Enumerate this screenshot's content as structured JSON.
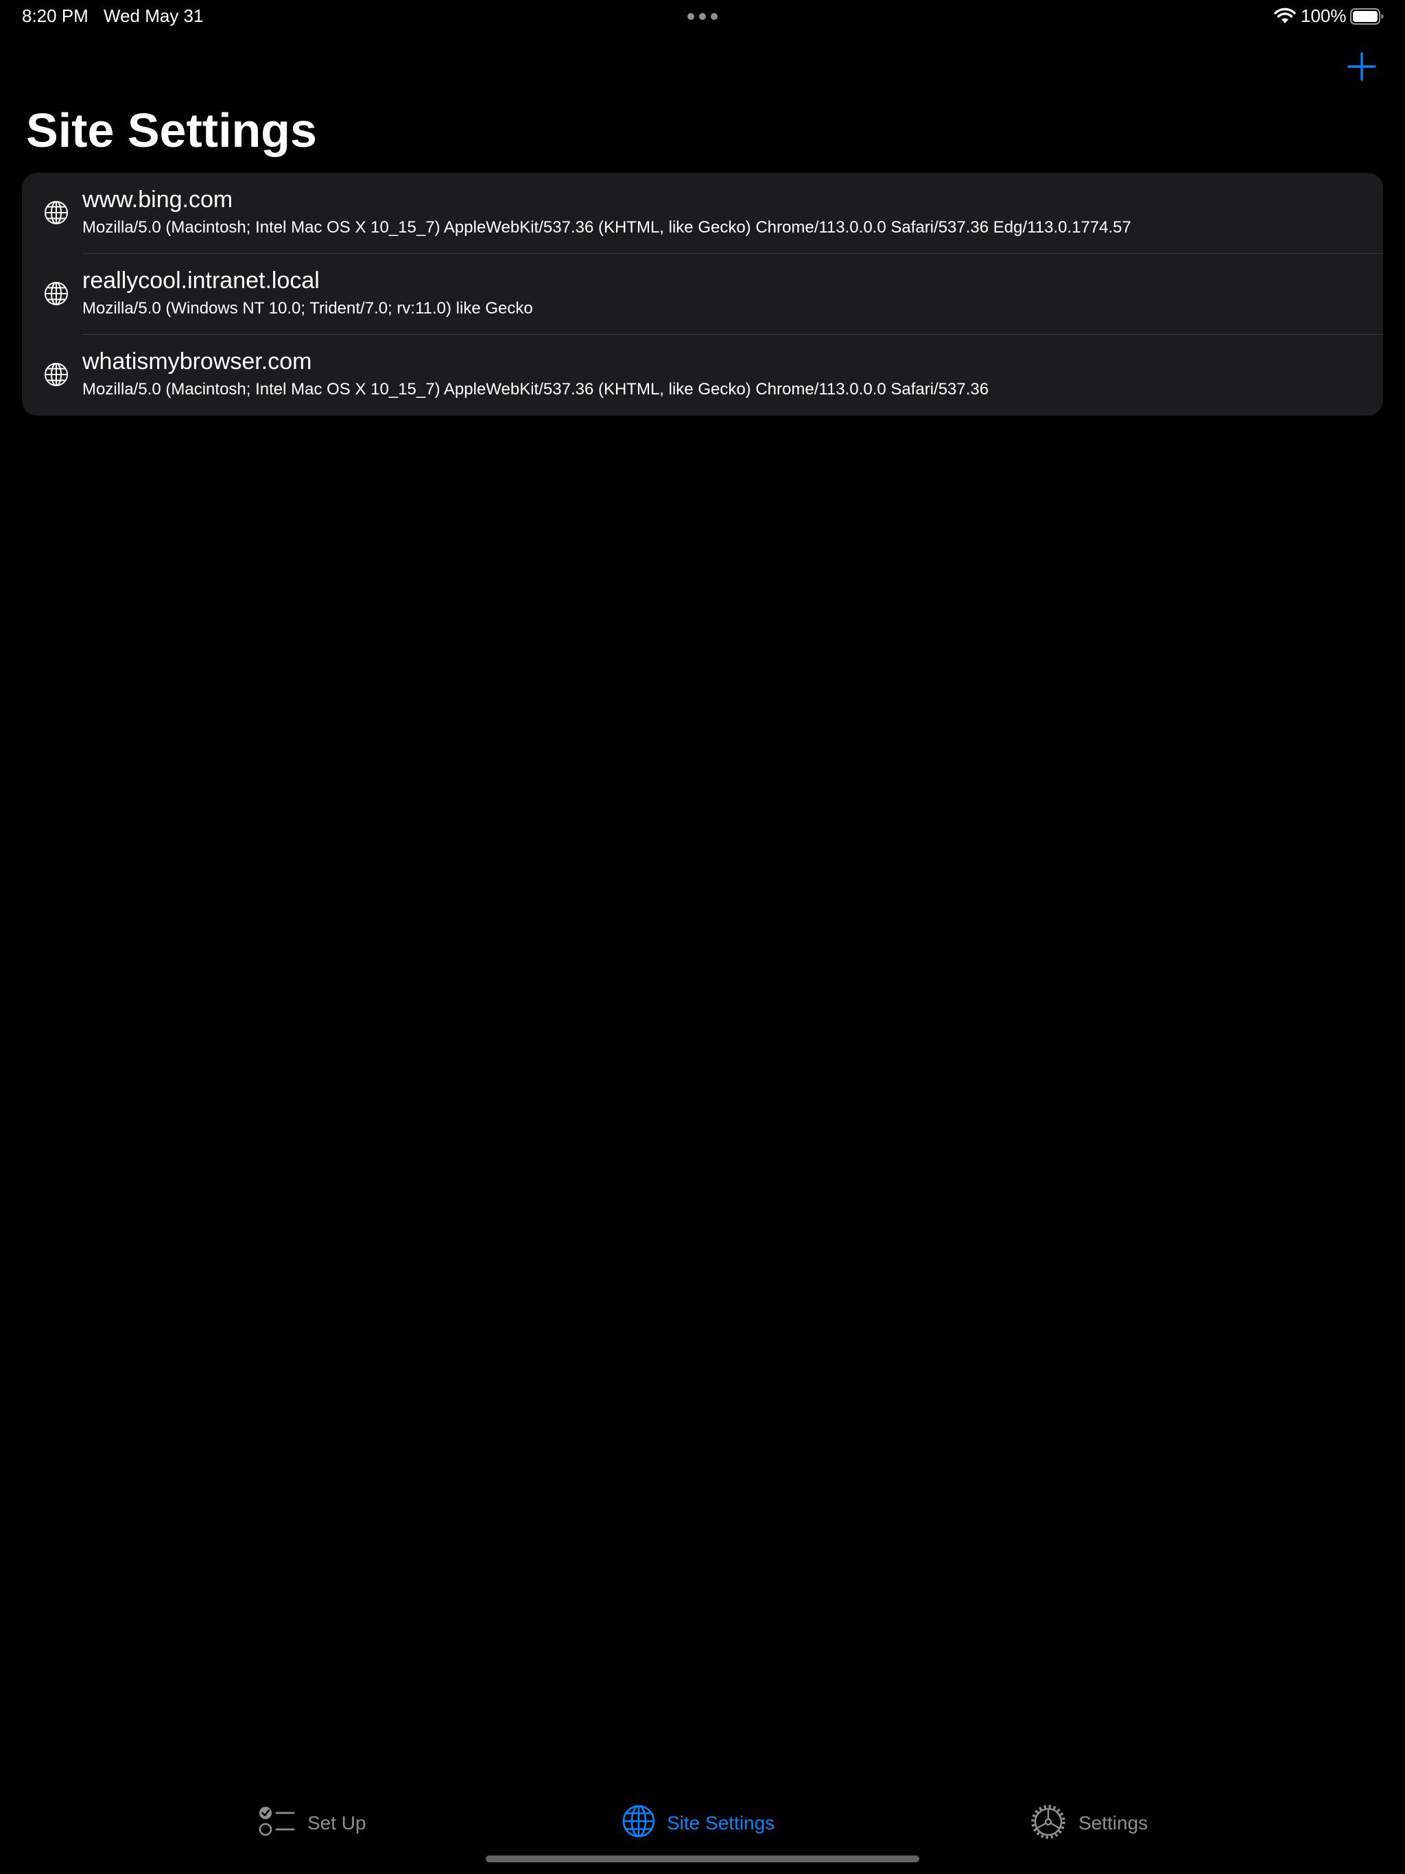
{
  "status_bar": {
    "time": "8:20 PM",
    "date": "Wed May 31",
    "battery_percent": "100%",
    "battery_level": 1.0
  },
  "nav": {
    "title": "Site Settings",
    "add_icon": "plus-icon"
  },
  "sites": [
    {
      "host": "www.bing.com",
      "user_agent": "Mozilla/5.0 (Macintosh; Intel Mac OS X 10_15_7) AppleWebKit/537.36 (KHTML, like Gecko) Chrome/113.0.0.0 Safari/537.36 Edg/113.0.1774.57",
      "icon": "globe-icon"
    },
    {
      "host": "reallycool.intranet.local",
      "user_agent": "Mozilla/5.0 (Windows NT 10.0; Trident/7.0; rv:11.0) like Gecko",
      "icon": "globe-icon"
    },
    {
      "host": "whatismybrowser.com",
      "user_agent": "Mozilla/5.0 (Macintosh; Intel Mac OS X 10_15_7) AppleWebKit/537.36 (KHTML, like Gecko) Chrome/113.0.0.0 Safari/537.36",
      "icon": "globe-icon"
    }
  ],
  "tabs": [
    {
      "label": "Set Up",
      "icon": "checklist-icon",
      "selected": false
    },
    {
      "label": "Site Settings",
      "icon": "globe-icon",
      "selected": true
    },
    {
      "label": "Settings",
      "icon": "gear-icon",
      "selected": false
    }
  ],
  "colors": {
    "background": "#000000",
    "list_background": "#1c1c1e",
    "accent": "#0a84ff",
    "inactive_tab": "#8e8e93",
    "separator": "#38383a"
  }
}
